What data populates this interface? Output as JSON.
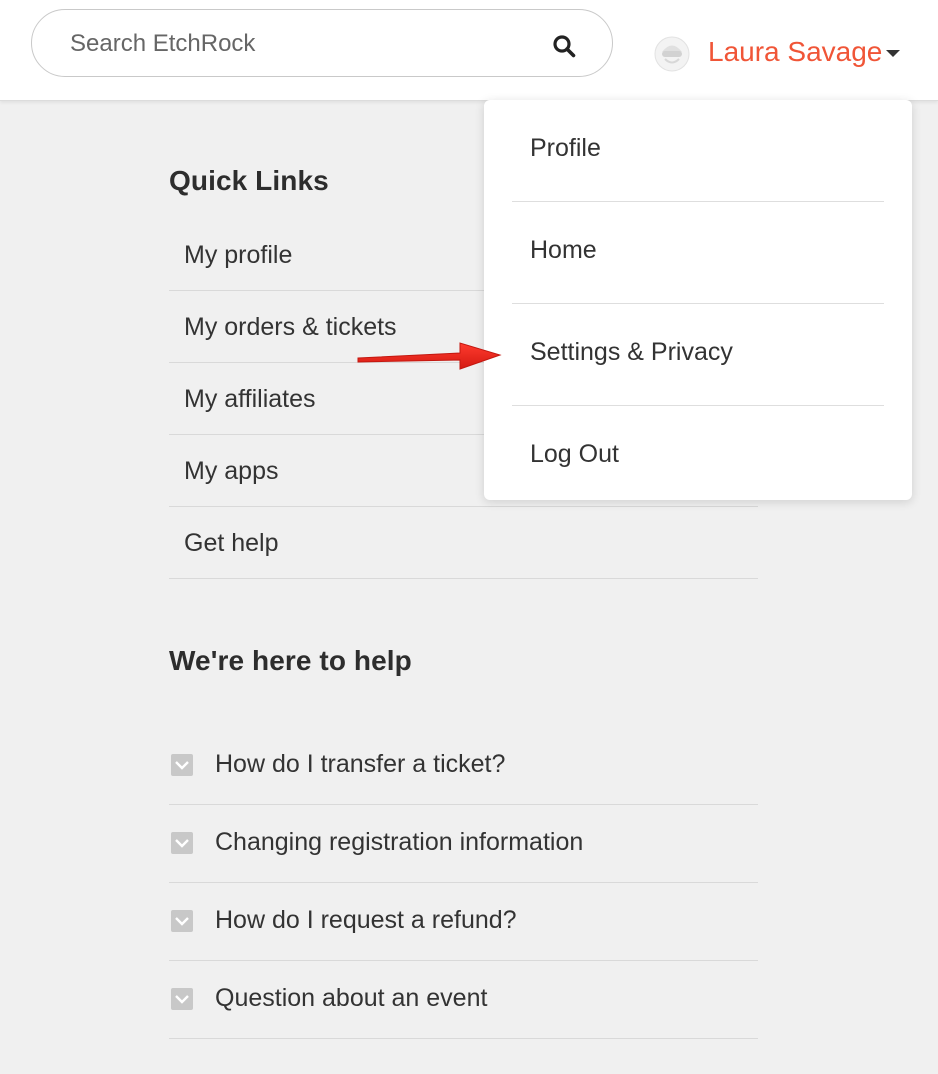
{
  "header": {
    "search": {
      "placeholder": "Search EtchRock",
      "icon": "search-icon"
    },
    "user": {
      "name": "Laura Savage",
      "name_color": "#f05537",
      "avatar_icon": "avatar-icon",
      "caret_icon": "caret-down-icon"
    }
  },
  "dropdown": {
    "items": [
      {
        "label": "Profile"
      },
      {
        "label": "Home"
      },
      {
        "label": "Settings & Privacy"
      },
      {
        "label": "Log Out"
      }
    ]
  },
  "quick_links": {
    "title": "Quick Links",
    "items": [
      {
        "label": "My profile"
      },
      {
        "label": "My orders & tickets"
      },
      {
        "label": "My affiliates"
      },
      {
        "label": "My apps"
      },
      {
        "label": "Get help"
      }
    ]
  },
  "help": {
    "title": "We're here to help",
    "items": [
      {
        "label": "How do I transfer a ticket?"
      },
      {
        "label": "Changing registration information"
      },
      {
        "label": "How do I request a refund?"
      },
      {
        "label": "Question about an event"
      }
    ]
  },
  "annotation": {
    "arrow_color": "#e8231a",
    "points_to": "Settings & Privacy"
  }
}
